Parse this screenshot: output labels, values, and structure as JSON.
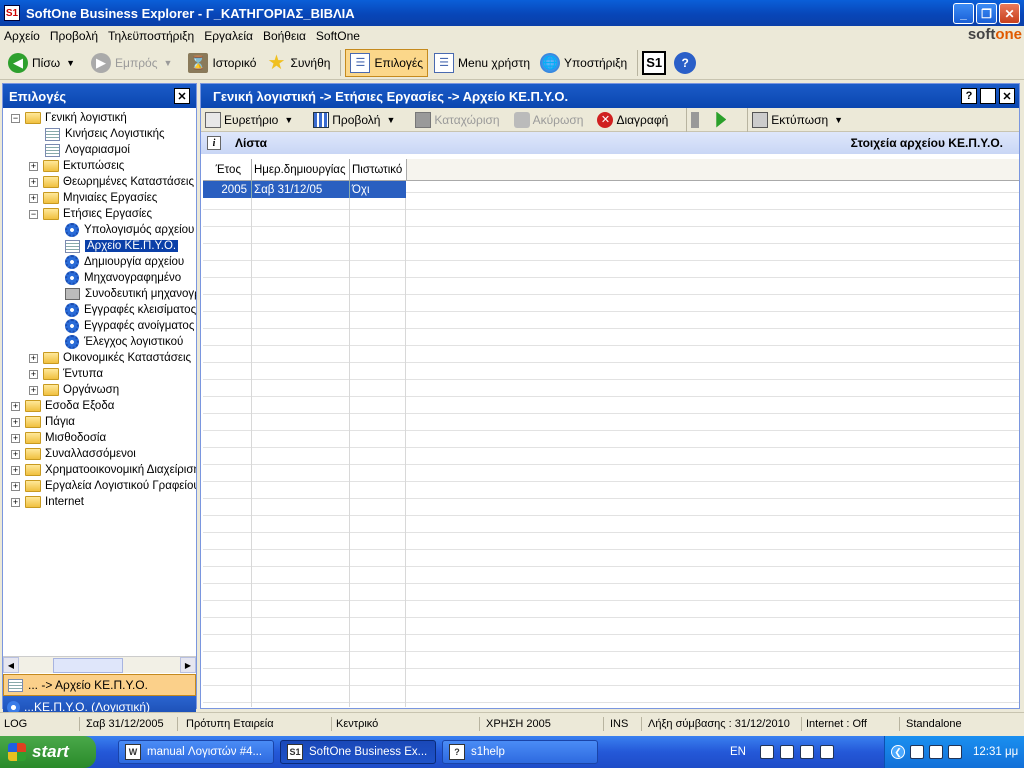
{
  "window": {
    "title": "SoftOne Business Explorer - Γ_ΚΑΤΗΓΟΡΙΑΣ_ΒΙΒΛΙΑ",
    "icon_text": "S1"
  },
  "menu": [
    "Αρχείο",
    "Προβολή",
    "Τηλεϋποστήριξη",
    "Εργαλεία",
    "Βοήθεια",
    "SoftOne"
  ],
  "logo": {
    "part1": "soft",
    "part2": "one"
  },
  "toolbar": {
    "back": "Πίσω",
    "forward": "Εμπρός",
    "history": "Ιστορικό",
    "favorites": "Συνήθη",
    "options": "Επιλογές",
    "user_menu": "Menu χρήστη",
    "support": "Υποστήριξη",
    "s1": "S1"
  },
  "left_panel": {
    "title": "Επιλογές",
    "tree": [
      {
        "label": "Γενική λογιστική",
        "pm": "−"
      },
      {
        "label": "Κινήσεις Λογιστικής"
      },
      {
        "label": "Λογαριασμοί"
      },
      {
        "label": "Εκτυπώσεις",
        "pm": "+"
      },
      {
        "label": "Θεωρημένες Καταστάσεις",
        "pm": "+"
      },
      {
        "label": "Μηνιαίες Εργασίες",
        "pm": "+"
      },
      {
        "label": "Ετήσιες Εργασίες",
        "pm": "−"
      },
      {
        "label": "Υπολογισμός αρχείου"
      },
      {
        "label": "Αρχείο ΚΕ.Π.Υ.Ο."
      },
      {
        "label": "Δημιουργία αρχείου"
      },
      {
        "label": "Μηχανογραφημένο"
      },
      {
        "label": "Συνοδευτική μηχανογραφημένου"
      },
      {
        "label": "Εγγραφές κλεισίματος"
      },
      {
        "label": "Εγγραφές ανοίγματος"
      },
      {
        "label": "Έλεγχος λογιστικού"
      },
      {
        "label": "Οικονομικές Καταστάσεις",
        "pm": "+"
      },
      {
        "label": "Έντυπα",
        "pm": "+"
      },
      {
        "label": "Οργάνωση",
        "pm": "+"
      },
      {
        "label": "Εσοδα Εξοδα",
        "pm": "+"
      },
      {
        "label": "Πάγια",
        "pm": "+"
      },
      {
        "label": "Μισθοδοσία",
        "pm": "+"
      },
      {
        "label": "Συναλλασσόμενοι",
        "pm": "+"
      },
      {
        "label": "Χρηματοοικονομική Διαχείριση",
        "pm": "+"
      },
      {
        "label": "Εργαλεία Λογιστικού Γραφείου",
        "pm": "+"
      },
      {
        "label": "Internet",
        "pm": "+"
      }
    ],
    "bottom_items": [
      "... -> Αρχείο ΚΕ.Π.Υ.Ο.",
      "...ΚΕ.Π.Υ.Ο. (Λογιστική)"
    ]
  },
  "right_panel": {
    "title": "Γενική λογιστική -> Ετήσιες Εργασίες -> Αρχείο ΚΕ.Π.Υ.Ο.",
    "buttons": {
      "help": "?",
      "close": "✕"
    },
    "toolbar": {
      "browse": "Ευρετήριο",
      "view": "Προβολή",
      "save": "Καταχώριση",
      "cancel": "Ακύρωση",
      "delete": "Διαγραφή",
      "print": "Εκτύπωση"
    },
    "list_title": "Λίστα",
    "details_title": "Στοιχεία αρχείου ΚΕ.Π.Υ.Ο.",
    "columns": [
      "Έτος",
      "Ημερ.δημιουργίας",
      "Πιστωτικό"
    ],
    "rows": [
      {
        "year": "2005",
        "created": "Σαβ 31/12/05",
        "credit": "Όχι"
      }
    ]
  },
  "status_bar": {
    "log": "LOG",
    "date": "Σαβ 31/12/2005",
    "company": "Πρότυπη Εταιρεία",
    "branch": "Κεντρικό",
    "fiscal_year": "ΧΡΗΣΗ 2005",
    "ins": "INS",
    "expiry": "Λήξη σύμβασης : 31/12/2010",
    "internet": "Internet : Off",
    "mode": "Standalone"
  },
  "taskbar": {
    "start": "start",
    "tasks": [
      "manual Λογιστών #4...",
      "SoftOne Business Ex...",
      "s1help"
    ],
    "lang": "EN",
    "clock": "12:31 μμ"
  }
}
